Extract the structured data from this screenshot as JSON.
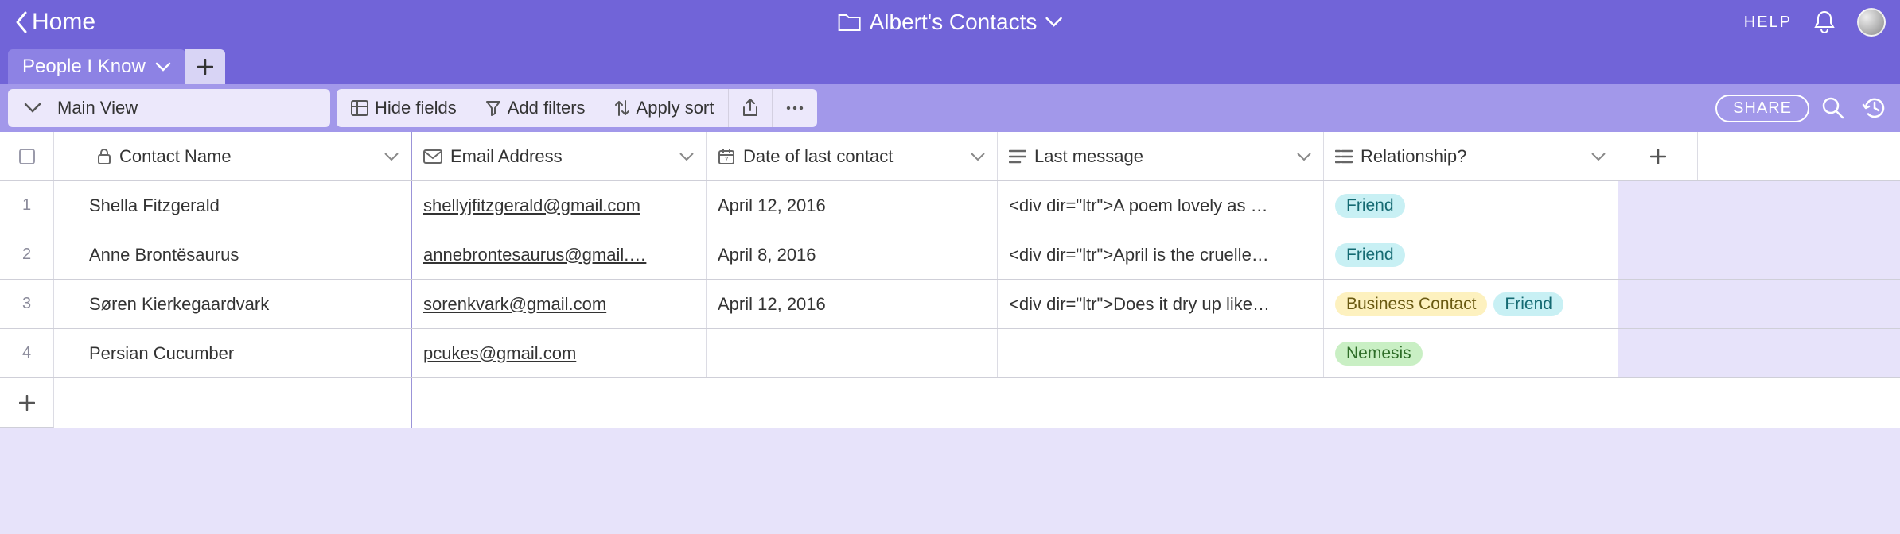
{
  "topbar": {
    "back_label": "Home",
    "doc_title": "Albert's Contacts",
    "help_label": "HELP"
  },
  "tabs": {
    "active": "People I Know"
  },
  "toolbar": {
    "view_label": "Main View",
    "hide_fields": "Hide fields",
    "add_filters": "Add filters",
    "apply_sort": "Apply sort",
    "share": "SHARE"
  },
  "columns": [
    {
      "label": "Contact Name"
    },
    {
      "label": "Email Address"
    },
    {
      "label": "Date of last contact"
    },
    {
      "label": "Last message"
    },
    {
      "label": "Relationship?"
    }
  ],
  "rows": [
    {
      "num": "1",
      "name": "Shella Fitzgerald",
      "email": "shellyjfitzgerald@gmail.com",
      "date": "April 12, 2016",
      "msg": "<div dir=\"ltr\">A poem lovely as …",
      "rel": [
        "Friend"
      ]
    },
    {
      "num": "2",
      "name": "Anne Brontësaurus",
      "email": "annebrontesaurus@gmail.…",
      "date": "April 8, 2016",
      "msg": "<div dir=\"ltr\">April is the cruelle…",
      "rel": [
        "Friend"
      ]
    },
    {
      "num": "3",
      "name": "Søren Kierkegaardvark",
      "email": "sorenkvark@gmail.com",
      "date": "April 12, 2016",
      "msg": "<div dir=\"ltr\">Does it dry up like…",
      "rel": [
        "Business Contact",
        "Friend"
      ]
    },
    {
      "num": "4",
      "name": "Persian Cucumber",
      "email": "pcukes@gmail.com",
      "date": "",
      "msg": "",
      "rel": [
        "Nemesis"
      ]
    }
  ],
  "pill_colors": {
    "Friend": "pill-friend",
    "Business Contact": "pill-business",
    "Nemesis": "pill-nemesis"
  }
}
